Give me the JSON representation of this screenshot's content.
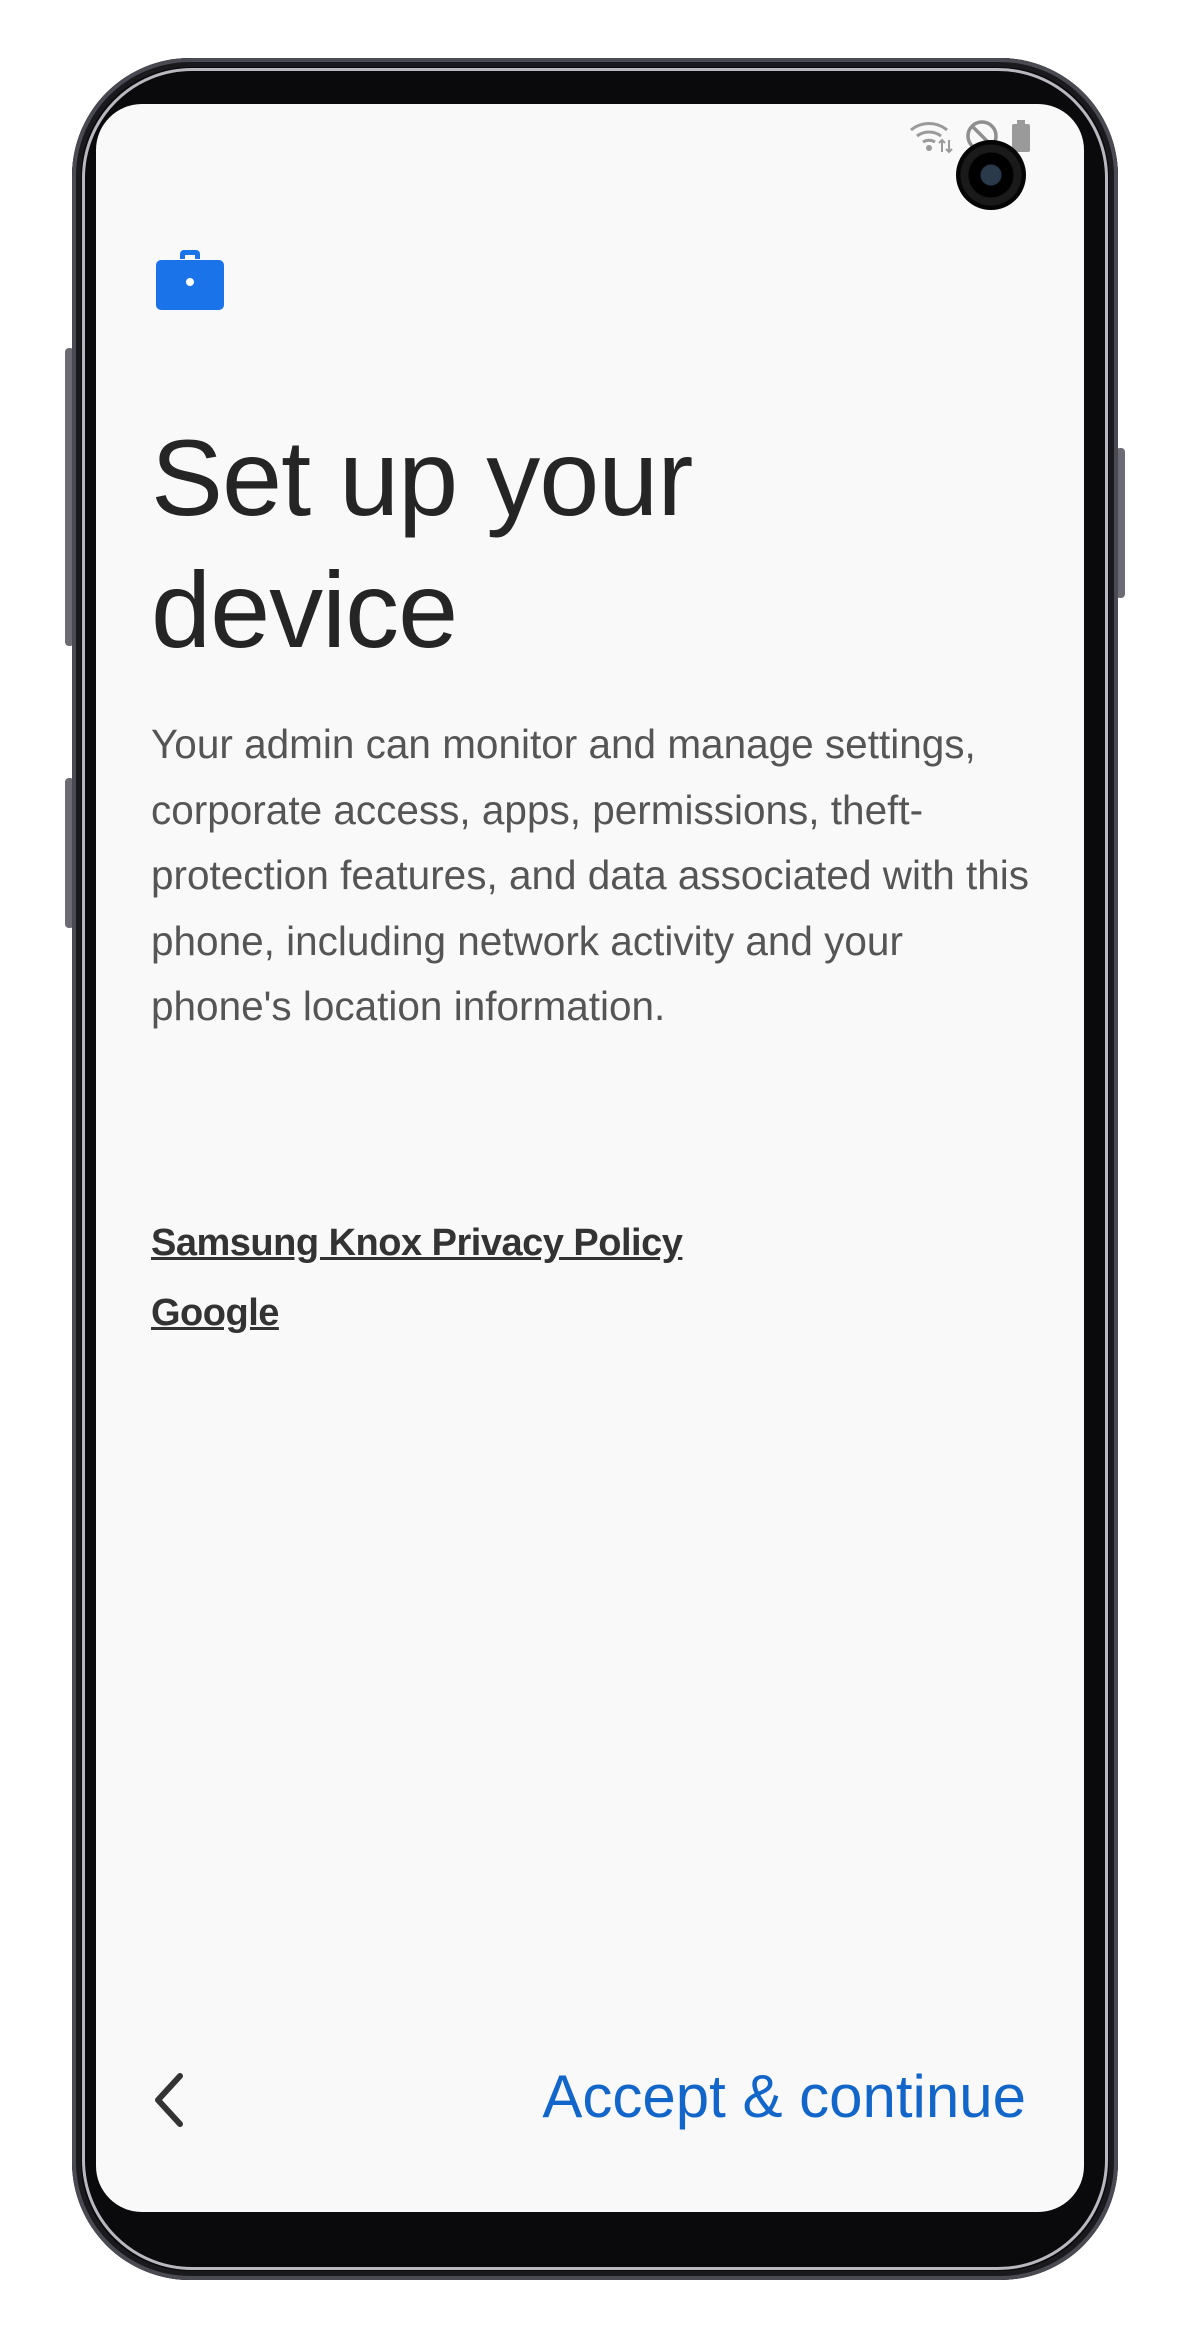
{
  "status_bar": {
    "icons": [
      "wifi-icon",
      "do-not-disturb-icon",
      "battery-icon"
    ]
  },
  "header": {
    "icon": "briefcase-icon",
    "title": "Set up your device"
  },
  "main": {
    "description": "Your admin can monitor and manage settings, corporate access, apps, permissions, theft-protection features, and data associated with this phone, including network activity and your phone's location information.",
    "links": {
      "knox_privacy": "Samsung Knox Privacy Policy",
      "google": "Google"
    }
  },
  "footer": {
    "back_icon": "chevron-left-icon",
    "accept_label": "Accept & continue"
  },
  "colors": {
    "accent": "#1366c9",
    "icon_blue": "#1a73e8",
    "screen_bg": "#f9f9f9",
    "title": "#252525",
    "body": "#555555"
  }
}
